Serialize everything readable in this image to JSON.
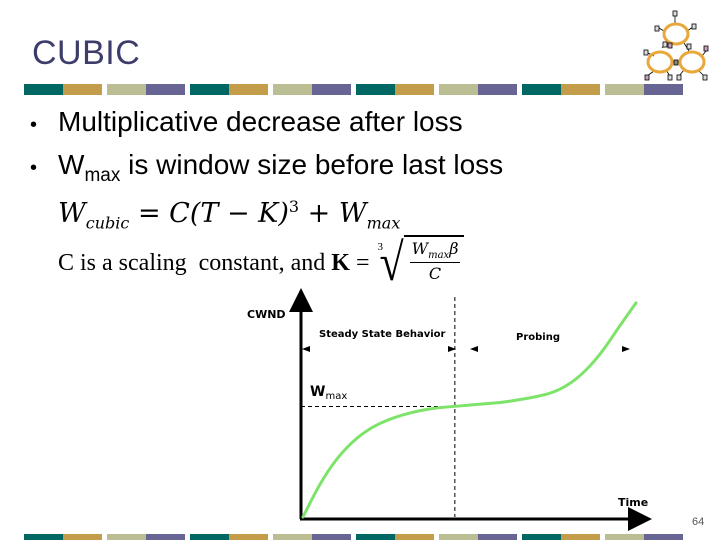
{
  "slide": {
    "title": "CUBIC",
    "page_number": "64",
    "bullets": [
      {
        "text": "Multiplicative decrease after loss"
      },
      {
        "prefix": "W",
        "subscript": "max",
        "text": " is window size before last loss"
      }
    ],
    "formula": {
      "line1": {
        "lhs_var": "W",
        "lhs_sub": "cubic",
        "equals": " = ",
        "rhs_main": "C(T − K)",
        "exponent": "3",
        "plus": " + ",
        "rhs_var": "W",
        "rhs_sub": "max"
      },
      "line2": {
        "text": "C is a scaling  constant, and",
        "k_label": "K",
        "equals": "=",
        "root_index": "3",
        "numerator_var": "W",
        "numerator_sub": "max",
        "numerator_beta": "β",
        "denominator": "C"
      }
    },
    "stripe_colors": [
      "#016762",
      "#c49d4b",
      "#bbbe93",
      "#676594"
    ],
    "logo": {
      "icon": "network-molecule-icon",
      "ring_color": "#e8a83a"
    }
  },
  "chart_data": {
    "type": "line",
    "title": "",
    "ylabel": "CWND",
    "xlabel": "Time",
    "y_marker_label": "W",
    "y_marker_sub": "max",
    "regions": [
      {
        "label": "Steady State Behavior"
      },
      {
        "label": "Probing"
      }
    ],
    "curve_color": "#7ee36a",
    "series": [
      {
        "name": "W_cubic",
        "description": "cubic growth: concave approach to Wmax, plateau at inflection, convex probing",
        "x": [
          0,
          0.05,
          0.1,
          0.15,
          0.2,
          0.25,
          0.3,
          0.35,
          0.4,
          0.45,
          0.5,
          0.55,
          0.6,
          0.65,
          0.7,
          0.75,
          0.8,
          0.85,
          0.9,
          0.95,
          1.0
        ],
        "y": [
          0.0,
          0.24,
          0.42,
          0.55,
          0.64,
          0.7,
          0.74,
          0.77,
          0.79,
          0.8,
          0.81,
          0.82,
          0.83,
          0.85,
          0.87,
          0.9,
          0.96,
          1.06,
          1.2,
          1.38,
          1.55
        ]
      }
    ],
    "wmax_level": 0.8,
    "inflection_x": 0.45,
    "xlim": [
      0,
      1.0
    ],
    "ylim": [
      0,
      1.6
    ]
  }
}
